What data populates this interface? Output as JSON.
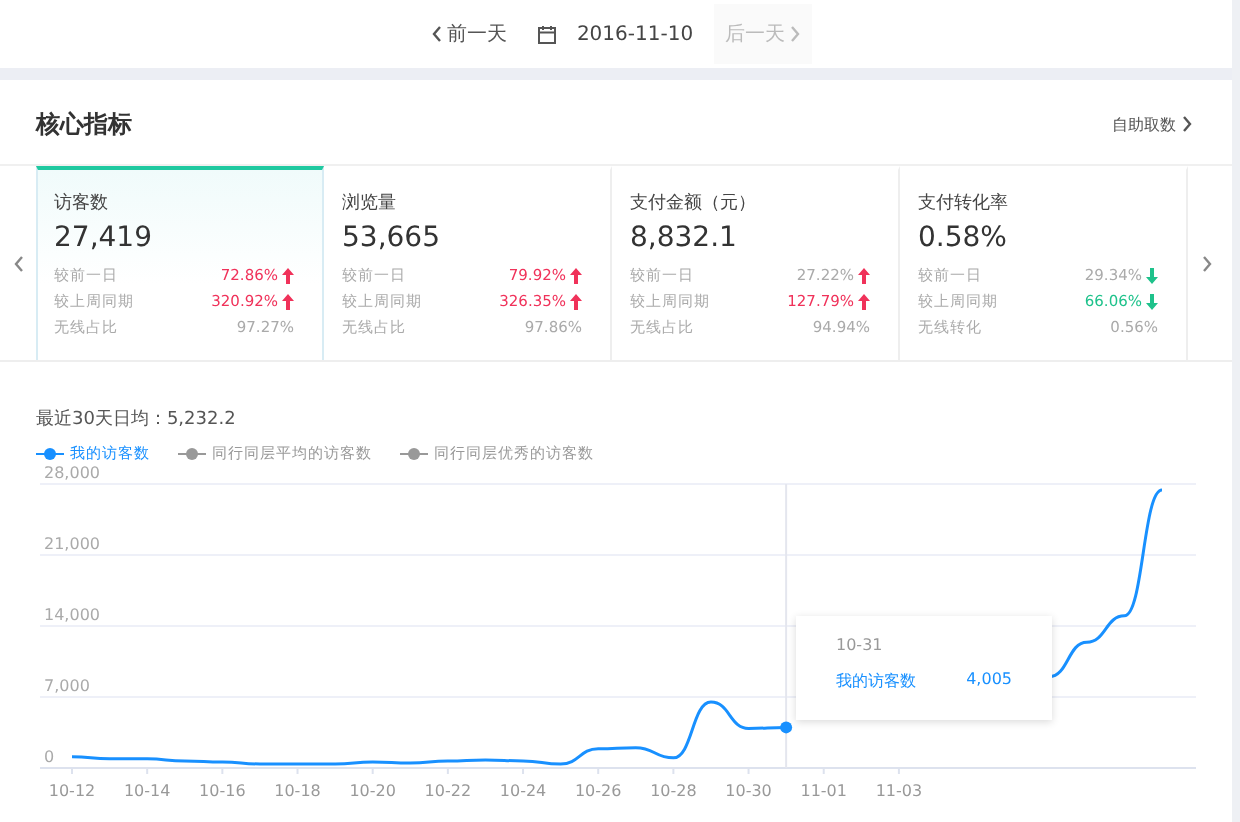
{
  "date_nav": {
    "prev": "前一天",
    "date": "2016-11-10",
    "next": "后一天",
    "next_disabled": true
  },
  "panel": {
    "title": "核心指标",
    "link": "自助取数"
  },
  "metrics": [
    {
      "name": "访客数",
      "value": "27,419",
      "selected": true,
      "rows": [
        {
          "kind": "change",
          "label": "较前一日",
          "value": "72.86%",
          "rising": true,
          "highlight": true
        },
        {
          "kind": "change",
          "label": "较上周同期",
          "value": "320.92%",
          "rising": true,
          "highlight": true
        },
        {
          "kind": "share",
          "label": "无线占比",
          "value": "97.27%"
        }
      ]
    },
    {
      "name": "浏览量",
      "value": "53,665",
      "selected": false,
      "rows": [
        {
          "kind": "change",
          "label": "较前一日",
          "value": "79.92%",
          "rising": true,
          "highlight": true
        },
        {
          "kind": "change",
          "label": "较上周同期",
          "value": "326.35%",
          "rising": true,
          "highlight": true
        },
        {
          "kind": "share",
          "label": "无线占比",
          "value": "97.86%"
        }
      ]
    },
    {
      "name": "支付金额（元）",
      "value": "8,832.1",
      "selected": false,
      "rows": [
        {
          "kind": "change",
          "label": "较前一日",
          "value": "27.22%",
          "rising": true,
          "highlight": false
        },
        {
          "kind": "change",
          "label": "较上周同期",
          "value": "127.79%",
          "rising": true,
          "highlight": true
        },
        {
          "kind": "share",
          "label": "无线占比",
          "value": "94.94%"
        }
      ]
    },
    {
      "name": "支付转化率",
      "value": "0.58%",
      "selected": false,
      "rows": [
        {
          "kind": "change",
          "label": "较前一日",
          "value": "29.34%",
          "rising": false,
          "highlight": false
        },
        {
          "kind": "change",
          "label": "较上周同期",
          "value": "66.06%",
          "rising": false,
          "highlight": true
        },
        {
          "kind": "share",
          "label": "无线转化",
          "value": "0.56%"
        }
      ]
    }
  ],
  "summary": "最近30天日均：5,232.2",
  "legend": [
    {
      "label": "我的访客数",
      "selected": true
    },
    {
      "label": "同行同层平均的访客数",
      "selected": false
    },
    {
      "label": "同行同层优秀的访客数",
      "selected": false
    }
  ],
  "chart_data": {
    "type": "line",
    "grid": true,
    "categories": [
      "10-12",
      null,
      "10-14",
      null,
      "10-16",
      null,
      "10-18",
      null,
      "10-20",
      null,
      "10-22",
      null,
      "10-24",
      null,
      "10-26",
      null,
      "10-28",
      null,
      "10-30",
      null,
      "11-01",
      null,
      "11-03",
      null,
      null,
      null,
      null,
      null,
      null,
      null
    ],
    "series": [
      {
        "color": "#1890ff",
        "values": [
          1100,
          900,
          900,
          700,
          600,
          400,
          400,
          400,
          600,
          500,
          700,
          800,
          700,
          400,
          1900,
          2000,
          1000,
          6500,
          3900,
          4005,
          null,
          null,
          null,
          null,
          null,
          null,
          9000,
          12400,
          15000,
          27400
        ]
      }
    ],
    "yticks": [
      {
        "value": 0,
        "label": "0"
      },
      {
        "value": 7000,
        "label": "7,000"
      },
      {
        "value": 14000,
        "label": "14,000"
      },
      {
        "value": 21000,
        "label": "21,000"
      },
      {
        "value": 28000,
        "label": "28,000"
      }
    ],
    "ylim": [
      0,
      28000
    ]
  },
  "tooltip": {
    "date": "10-31",
    "series": "我的访客数",
    "value": "4,005"
  }
}
